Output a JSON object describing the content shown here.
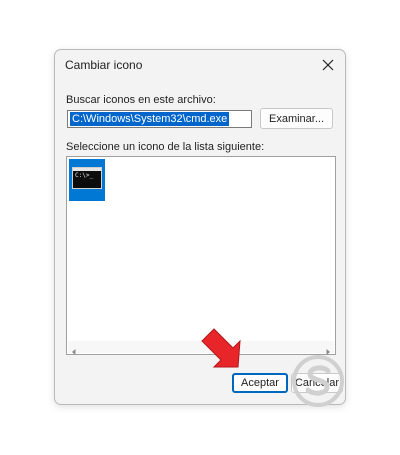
{
  "dialog": {
    "title": "Cambiar icono",
    "search_label": "Buscar iconos en este archivo:",
    "path_value": "C:\\Windows\\System32\\cmd.exe",
    "browse_label": "Examinar...",
    "list_label": "Seleccione un icono de la lista siguiente:",
    "icons": [
      {
        "icon": "cmd-icon",
        "prompt": "C:\\>_",
        "selected": true
      }
    ],
    "ok_label": "Aceptar",
    "cancel_label": "Cancelar"
  },
  "colors": {
    "selection": "#0078d4",
    "accent_border": "#0067c0",
    "arrow": "#e8262a",
    "watermark": "#d0d0d0"
  }
}
